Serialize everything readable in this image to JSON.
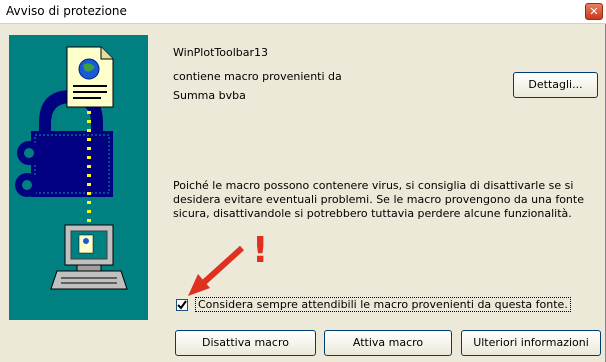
{
  "window": {
    "title": "Avviso di protezione",
    "close_glyph": "✕"
  },
  "source": {
    "name": "WinPlotToolbar13",
    "line1": "contiene macro provenienti da",
    "publisher": "Summa bvba"
  },
  "details_button": {
    "label": "Dettagli..."
  },
  "warning": {
    "line1": "Poiché le macro possono contenere virus, si consiglia di disattivarle se si",
    "line2": "desidera evitare eventuali problemi. Se le macro provengono da una fonte",
    "line3": "sicura, disattivandole si potrebbero tuttavia perdere alcune funzionalità."
  },
  "trust_checkbox": {
    "checked": true,
    "label": "Considera sempre attendibili le macro provenienti da questa fonte."
  },
  "buttons": {
    "disable": "Disattiva macro",
    "enable": "Attiva macro",
    "more_info": "Ulteriori informazioni"
  },
  "annotation": {
    "exclamation": "!",
    "color": "#e03020"
  },
  "colors": {
    "teal": "#008080",
    "navy": "#000080",
    "dialog_bg": "#ece9d8"
  },
  "icons": [
    "document-globe-icon",
    "padlock-icon",
    "computer-icon",
    "checkmark-icon",
    "close-icon",
    "red-arrow-annotation"
  ]
}
